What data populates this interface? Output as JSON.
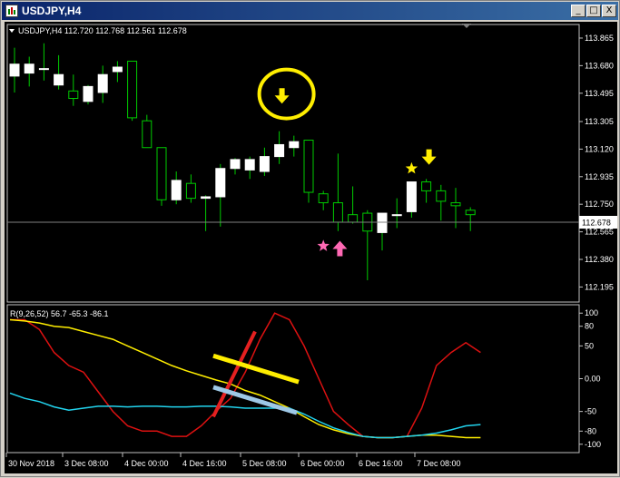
{
  "window": {
    "title": "USDJPY,H4",
    "buttons": {
      "minimize": "_",
      "maximize": "□",
      "close": "X"
    }
  },
  "main_panel": {
    "header": "USDJPY,H4  112.720 112.768 112.561 112.678",
    "current_price": "112.678",
    "price_labels": [
      "113.865",
      "113.680",
      "113.495",
      "113.305",
      "113.120",
      "112.935",
      "112.750",
      "112.565",
      "112.380",
      "112.195"
    ]
  },
  "indicator_panel": {
    "header": "R(9,26,52) 56.7 -65.3 -86.1",
    "level_labels": [
      "100",
      "80",
      "50",
      "0.00",
      "-50",
      "-80",
      "-100"
    ]
  },
  "time_labels": [
    "30 Nov 2018",
    "3 Dec 08:00",
    "4 Dec 00:00",
    "4 Dec 16:00",
    "5 Dec 08:00",
    "6 Dec 00:00",
    "6 Dec 16:00",
    "7 Dec 08:00"
  ],
  "colors": {
    "background": "#000000",
    "bull_candle": "#ffffff",
    "wick": "#00cc00",
    "annotation_yellow": "#ffee00",
    "annotation_pink": "#ff69b4",
    "line_red": "#dd1111",
    "line_yellow": "#ffee00",
    "line_cyan": "#22d4ee"
  },
  "chart_data": {
    "type": "candlestick",
    "symbol": "USDJPY",
    "timeframe": "H4",
    "ylim": [
      112.1,
      113.95
    ],
    "candles": [
      {
        "o": 113.61,
        "h": 113.8,
        "l": 113.5,
        "c": 113.69
      },
      {
        "o": 113.63,
        "h": 113.74,
        "l": 113.54,
        "c": 113.69
      },
      {
        "o": 113.66,
        "h": 113.83,
        "l": 113.58,
        "c": 113.66
      },
      {
        "o": 113.55,
        "h": 113.75,
        "l": 113.52,
        "c": 113.62
      },
      {
        "o": 113.51,
        "h": 113.62,
        "l": 113.41,
        "c": 113.46
      },
      {
        "o": 113.44,
        "h": 113.55,
        "l": 113.42,
        "c": 113.54
      },
      {
        "o": 113.5,
        "h": 113.68,
        "l": 113.43,
        "c": 113.62
      },
      {
        "o": 113.64,
        "h": 113.71,
        "l": 113.57,
        "c": 113.67
      },
      {
        "o": 113.71,
        "h": 113.71,
        "l": 113.31,
        "c": 113.33
      },
      {
        "o": 113.31,
        "h": 113.35,
        "l": 113.14,
        "c": 113.13
      },
      {
        "o": 113.13,
        "h": 113.13,
        "l": 112.74,
        "c": 112.78
      },
      {
        "o": 112.78,
        "h": 112.97,
        "l": 112.75,
        "c": 112.91
      },
      {
        "o": 112.89,
        "h": 112.95,
        "l": 112.76,
        "c": 112.79
      },
      {
        "o": 112.79,
        "h": 112.81,
        "l": 112.57,
        "c": 112.8
      },
      {
        "o": 112.8,
        "h": 113.02,
        "l": 112.6,
        "c": 112.99
      },
      {
        "o": 112.99,
        "h": 113.06,
        "l": 112.95,
        "c": 113.05
      },
      {
        "o": 112.98,
        "h": 113.07,
        "l": 112.92,
        "c": 113.05
      },
      {
        "o": 112.97,
        "h": 113.13,
        "l": 112.94,
        "c": 113.07
      },
      {
        "o": 113.07,
        "h": 113.24,
        "l": 113.02,
        "c": 113.15
      },
      {
        "o": 113.13,
        "h": 113.21,
        "l": 113.07,
        "c": 113.17
      },
      {
        "o": 113.18,
        "h": 113.18,
        "l": 112.76,
        "c": 112.83
      },
      {
        "o": 112.82,
        "h": 112.84,
        "l": 112.71,
        "c": 112.76
      },
      {
        "o": 112.76,
        "h": 113.09,
        "l": 112.57,
        "c": 112.63
      },
      {
        "o": 112.68,
        "h": 112.87,
        "l": 112.62,
        "c": 112.63
      },
      {
        "o": 112.69,
        "h": 112.71,
        "l": 112.24,
        "c": 112.57
      },
      {
        "o": 112.56,
        "h": 112.67,
        "l": 112.44,
        "c": 112.69
      },
      {
        "o": 112.68,
        "h": 112.79,
        "l": 112.59,
        "c": 112.68
      },
      {
        "o": 112.7,
        "h": 112.89,
        "l": 112.66,
        "c": 112.9
      },
      {
        "o": 112.9,
        "h": 112.92,
        "l": 112.76,
        "c": 112.84
      },
      {
        "o": 112.84,
        "h": 112.88,
        "l": 112.64,
        "c": 112.77
      },
      {
        "o": 112.76,
        "h": 112.86,
        "l": 112.59,
        "c": 112.74
      },
      {
        "o": 112.71,
        "h": 112.73,
        "l": 112.57,
        "c": 112.68
      }
    ],
    "indicator": {
      "name": "R(9,26,52)",
      "ylim": [
        -110,
        110
      ],
      "series": [
        {
          "values": [
            90,
            90,
            75,
            40,
            20,
            10,
            -20,
            -50,
            -72,
            -80,
            -80,
            -88,
            -88,
            -72,
            -50,
            -30,
            10,
            60,
            100,
            90,
            50,
            0,
            -50,
            -70,
            -88,
            -90,
            -90,
            -88,
            -45,
            20,
            40,
            55,
            40
          ]
        },
        {
          "values": [
            90,
            88,
            85,
            80,
            78,
            72,
            66,
            60,
            50,
            40,
            30,
            20,
            12,
            5,
            -2,
            -8,
            -18,
            -25,
            -35,
            -45,
            -58,
            -70,
            -78,
            -84,
            -88,
            -90,
            -90,
            -88,
            -86,
            -86,
            -88,
            -90,
            -90
          ]
        },
        {
          "values": [
            -22,
            -30,
            -35,
            -43,
            -48,
            -45,
            -42,
            -42,
            -43,
            -42,
            -42,
            -43,
            -43,
            -42,
            -42,
            -43,
            -45,
            -45,
            -45,
            -45,
            -54,
            -65,
            -75,
            -82,
            -88,
            -90,
            -90,
            -88,
            -86,
            -83,
            -78,
            -72,
            -70
          ]
        }
      ]
    },
    "annotations": [
      {
        "type": "circle",
        "color": "yellow",
        "candle": 18
      },
      {
        "type": "arrow-down",
        "color": "yellow",
        "candle": 18,
        "price": 113.48
      },
      {
        "type": "star",
        "color": "yellow",
        "candle": 27,
        "price": 112.99
      },
      {
        "type": "arrow-down",
        "color": "yellow",
        "candle": 28,
        "price": 113.07
      },
      {
        "type": "star",
        "color": "pink",
        "candle": 21,
        "price": 112.47
      },
      {
        "type": "arrow-up",
        "color": "pink",
        "candle": 22,
        "price": 112.45
      }
    ]
  }
}
